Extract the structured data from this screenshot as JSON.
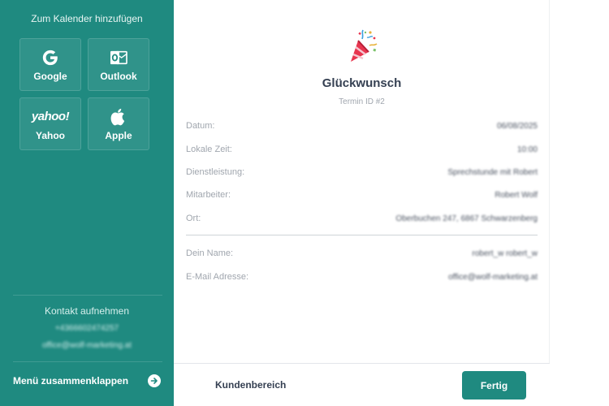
{
  "sidebar": {
    "calendar_title": "Zum Kalender hinzufügen",
    "calendar_buttons": [
      {
        "label": "Google",
        "icon": "google-icon"
      },
      {
        "label": "Outlook",
        "icon": "outlook-icon"
      },
      {
        "label": "Yahoo",
        "icon": "yahoo-icon",
        "icon_text": "yahoo!"
      },
      {
        "label": "Apple",
        "icon": "apple-icon"
      }
    ],
    "contact": {
      "title": "Kontakt aufnehmen",
      "phone": "+4366602474257",
      "email": "office@wolf-marketing.at"
    },
    "collapse_label": "Menü zusammenklappen"
  },
  "main": {
    "title": "Glückwunsch",
    "subtitle": "Termin ID #2",
    "details": [
      {
        "label": "Datum:",
        "value": "06/08/2025"
      },
      {
        "label": "Lokale Zeit:",
        "value": "10:00"
      },
      {
        "label": "Dienstleistung:",
        "value": "Sprechstunde mit Robert"
      },
      {
        "label": "Mitarbeiter:",
        "value": "Robert Wolf"
      },
      {
        "label": "Ort:",
        "value": "Oberbuchen 247, 6867 Schwarzenberg"
      }
    ],
    "customer": [
      {
        "label": "Dein Name:",
        "value": "robert_w robert_w"
      },
      {
        "label": "E-Mail Adresse:",
        "value": "office@wolf-marketing.at"
      }
    ],
    "footer": {
      "link_label": "Kundenbereich",
      "primary_label": "Fertig"
    }
  },
  "colors": {
    "accent": "#1f8a80",
    "text_dark": "#354052",
    "text_muted": "#a0a6ae"
  }
}
